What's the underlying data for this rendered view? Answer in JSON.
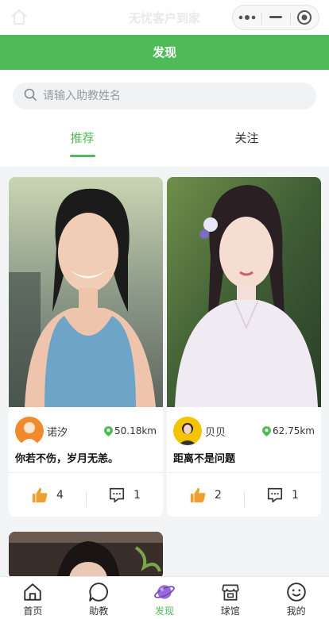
{
  "topbar": {
    "title": "无忧客户到家",
    "icons": [
      "home-icon",
      "more-dots-icon",
      "minimize-icon",
      "close-circle-icon"
    ]
  },
  "header": {
    "title": "发现"
  },
  "search": {
    "placeholder": "请输入助教姓名",
    "value": "",
    "icon": "search-icon"
  },
  "tabs": [
    {
      "label": "推荐",
      "active": true
    },
    {
      "label": "关注",
      "active": false
    }
  ],
  "cards": [
    {
      "name": "诺汐",
      "distance": "50.18km",
      "motto": "你若不伤，岁月无恙。",
      "likes": "4",
      "comments": "1"
    },
    {
      "name": "贝贝",
      "distance": "62.75km",
      "motto": "距离不是问题",
      "likes": "2",
      "comments": "1"
    }
  ],
  "nav": [
    {
      "label": "首页",
      "icon": "home-icon",
      "active": false
    },
    {
      "label": "助教",
      "icon": "chat-bubble-icon",
      "active": false
    },
    {
      "label": "发现",
      "icon": "planet-icon",
      "active": true
    },
    {
      "label": "球馆",
      "icon": "store-icon",
      "active": false
    },
    {
      "label": "我的",
      "icon": "smile-face-icon",
      "active": false
    }
  ],
  "colors": {
    "accent": "#4fba58",
    "like": "#f0a030",
    "pin": "#4fba58"
  }
}
